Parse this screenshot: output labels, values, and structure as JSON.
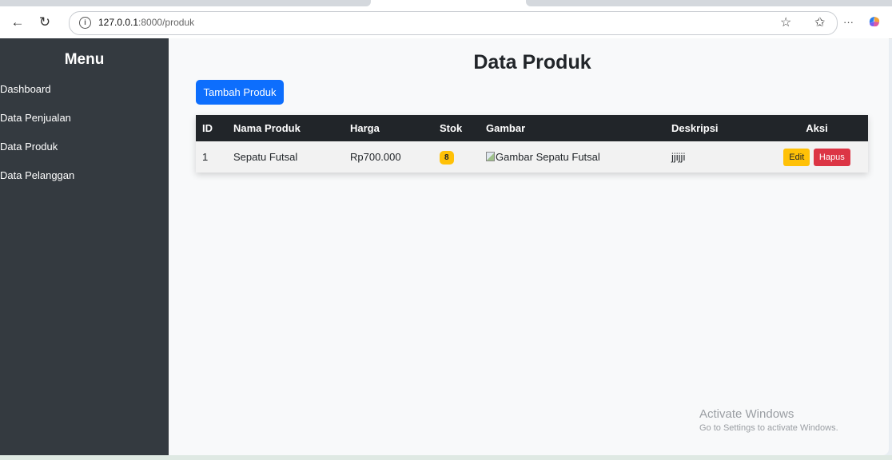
{
  "browser": {
    "url_host": "127.0.0.1",
    "url_path": ":8000/produk",
    "more_label": "···"
  },
  "sidebar": {
    "title": "Menu",
    "items": [
      {
        "label": "Dashboard"
      },
      {
        "label": "Data Penjualan"
      },
      {
        "label": "Data Produk"
      },
      {
        "label": "Data Pelanggan"
      }
    ]
  },
  "main": {
    "title": "Data Produk",
    "add_button": "Tambah Produk",
    "table": {
      "headers": [
        "ID",
        "Nama Produk",
        "Harga",
        "Stok",
        "Gambar",
        "Deskripsi",
        "Aksi"
      ],
      "rows": [
        {
          "id": "1",
          "nama": "Sepatu Futsal",
          "harga": "Rp700.000",
          "stok": "8",
          "gambar_alt": "Gambar Sepatu Futsal",
          "deskripsi": "jjijji",
          "edit_label": "Edit",
          "hapus_label": "Hapus"
        }
      ]
    }
  },
  "watermark": {
    "title": "Activate Windows",
    "subtitle": "Go to Settings to activate Windows."
  },
  "colors": {
    "sidebar_bg": "#343a40",
    "primary": "#0d6efd",
    "warning": "#ffc107",
    "danger": "#dc3545",
    "table_header": "#212529"
  }
}
